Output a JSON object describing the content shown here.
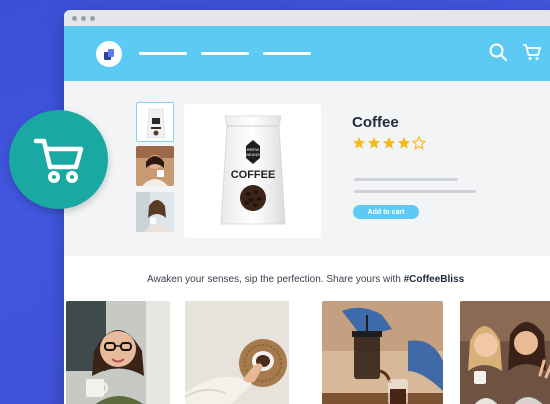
{
  "product": {
    "title": "Coffee",
    "rating": 4,
    "rating_max": 5,
    "add_to_cart_label": "Add to cart",
    "bag_brand_line1": "BREW",
    "bag_brand_line2": "BEANS",
    "bag_label": "COFFEE"
  },
  "ugc": {
    "tagline_prefix": "Awaken your senses, sip the perfection. Share yours with ",
    "hashtag": "#CoffeeBliss"
  },
  "icons": {
    "search": "search-icon",
    "cart": "cart-icon",
    "badge": "shopping-cart-icon"
  },
  "colors": {
    "background": "#3a4fd6",
    "navbar": "#5ccaf2",
    "accent": "#5ccaf2",
    "badge": "#19a9a2",
    "star": "#f5b922"
  }
}
